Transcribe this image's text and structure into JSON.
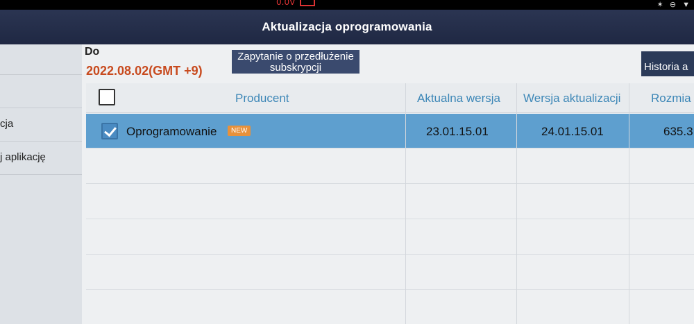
{
  "status_bar": {
    "voltage": "0.0V"
  },
  "header": {
    "title": "Aktualizacja oprogramowania"
  },
  "sidebar": {
    "items": [
      {
        "label": ""
      },
      {
        "label": ""
      },
      {
        "label": "cja"
      },
      {
        "label": "j aplikację"
      }
    ]
  },
  "main": {
    "do_label": "Do",
    "date": "2022.08.02(GMT +9)",
    "renew_button": "Zapytanie o przedłużenie subskrypcji",
    "history_button": "Historia a"
  },
  "table": {
    "columns": [
      "Producent",
      "Aktualna wersja",
      "Wersja aktualizacji",
      "Rozmia"
    ],
    "rows": [
      {
        "producer": "Oprogramowanie",
        "badge": "NEW",
        "current_version": "23.01.15.01",
        "update_version": "24.01.15.01",
        "size": "635.3",
        "checked": true,
        "selected": true
      }
    ]
  },
  "colors": {
    "title_bar": "#1f2843",
    "accent_blue": "#3d87b7",
    "selected_row": "#5e9fcf",
    "date_orange": "#c84a1e",
    "badge_orange": "#e8913b"
  }
}
